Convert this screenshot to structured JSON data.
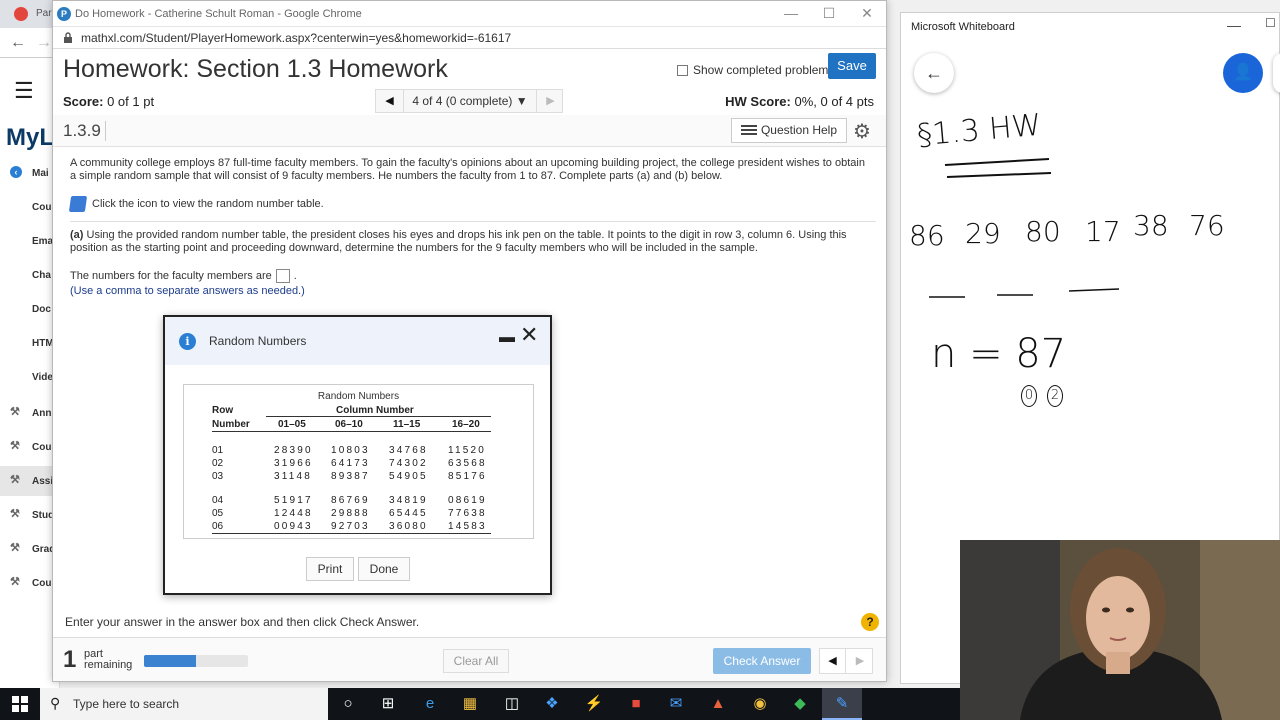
{
  "background_app": {
    "tab_label": "Par",
    "brand": "MyL",
    "nav_items": [
      {
        "label": "Mai",
        "icon": "back-circle-icon"
      },
      {
        "label": "Cou",
        "icon": ""
      },
      {
        "label": "Ema",
        "icon": ""
      },
      {
        "label": "Cha",
        "icon": ""
      },
      {
        "label": "Doc",
        "icon": ""
      },
      {
        "label": "HTM",
        "icon": ""
      },
      {
        "label": "Vide",
        "icon": ""
      },
      {
        "label": "Ann",
        "icon": "wrench-icon"
      },
      {
        "label": "Cou",
        "icon": "wrench-icon"
      },
      {
        "label": "Assi",
        "icon": "wrench-icon",
        "active": true
      },
      {
        "label": "Stud",
        "icon": "wrench-icon"
      },
      {
        "label": "Grad",
        "icon": "wrench-icon"
      },
      {
        "label": "Cou",
        "icon": "wrench-icon"
      }
    ]
  },
  "browser": {
    "title": "Do Homework - Catherine Schult Roman - Google Chrome",
    "url": "mathxl.com/Student/PlayerHomework.aspx?centerwin=yes&homeworkid=-61617"
  },
  "homework": {
    "title": "Homework: Section 1.3 Homework",
    "show_completed_label": "Show completed problem",
    "save_label": "Save",
    "score_label": "Score:",
    "score_value": "0 of 1 pt",
    "question_nav": "4 of 4 (0 complete)",
    "hw_score_label": "HW Score:",
    "hw_score_value": "0%, 0 of 4 pts",
    "question_number": "1.3.9",
    "question_help_label": "Question Help"
  },
  "question": {
    "problem_text": "A community college employs 87 full-time faculty members. To gain the faculty's opinions about an upcoming building project, the college president wishes to obtain a simple random sample that will consist of 9 faculty members. He numbers the faculty from 1 to 87. Complete parts (a) and (b) below.",
    "table_link_text": "Click the icon to view the random number table.",
    "part_a_label": "(a)",
    "part_a_text": "Using the provided random number table, the president closes his eyes and drops his ink pen on the table. It points to the digit in row 3, column 6. Using this position as the starting point and proceeding downward, determine the numbers for the 9 faculty members who will be included in the sample.",
    "answer_prompt": "The numbers for the faculty members are",
    "answer_value": "",
    "answer_hint": "(Use a comma to separate answers as needed.)"
  },
  "footer": {
    "instruction": "Enter your answer in the answer box and then click Check Answer.",
    "parts_remaining_count": "1",
    "parts_line1": "part",
    "parts_line2": "remaining",
    "progress_fraction": 0.5,
    "clear_all_label": "Clear All",
    "check_answer_label": "Check Answer",
    "help_symbol": "?"
  },
  "dialog": {
    "title": "Random Numbers",
    "table_caption": "Random Numbers",
    "row_header_1": "Row",
    "row_header_2": "Number",
    "column_group_header": "Column Number",
    "columns": [
      "01–05",
      "06–10",
      "11–15",
      "16–20"
    ],
    "rows": [
      {
        "row": "01",
        "values": [
          "28390",
          "10803",
          "34768",
          "11520"
        ]
      },
      {
        "row": "02",
        "values": [
          "31966",
          "64173",
          "74302",
          "63568"
        ]
      },
      {
        "row": "03",
        "values": [
          "31148",
          "89387",
          "54905",
          "85176"
        ]
      },
      {
        "row": "04",
        "values": [
          "51917",
          "86769",
          "34819",
          "08619"
        ]
      },
      {
        "row": "05",
        "values": [
          "12448",
          "29888",
          "65445",
          "77638"
        ]
      },
      {
        "row": "06",
        "values": [
          "00943",
          "92703",
          "36080",
          "14583"
        ]
      }
    ],
    "print_label": "Print",
    "done_label": "Done"
  },
  "whiteboard": {
    "app_title": "Microsoft Whiteboard",
    "ink_heading": "§1.3 HW",
    "ink_numbers": [
      "86",
      "29",
      "80",
      "17",
      "38",
      "76"
    ],
    "ink_equation": "n = 87",
    "ink_circled": [
      "0",
      "2"
    ]
  },
  "taskbar": {
    "search_placeholder": "Type here to search"
  },
  "colors": {
    "accent": "#1f73c2",
    "check_answer_disabled": "#8bbce6",
    "whiteboard_user": "#1a66d9",
    "hint_text": "#1b3c8c"
  }
}
